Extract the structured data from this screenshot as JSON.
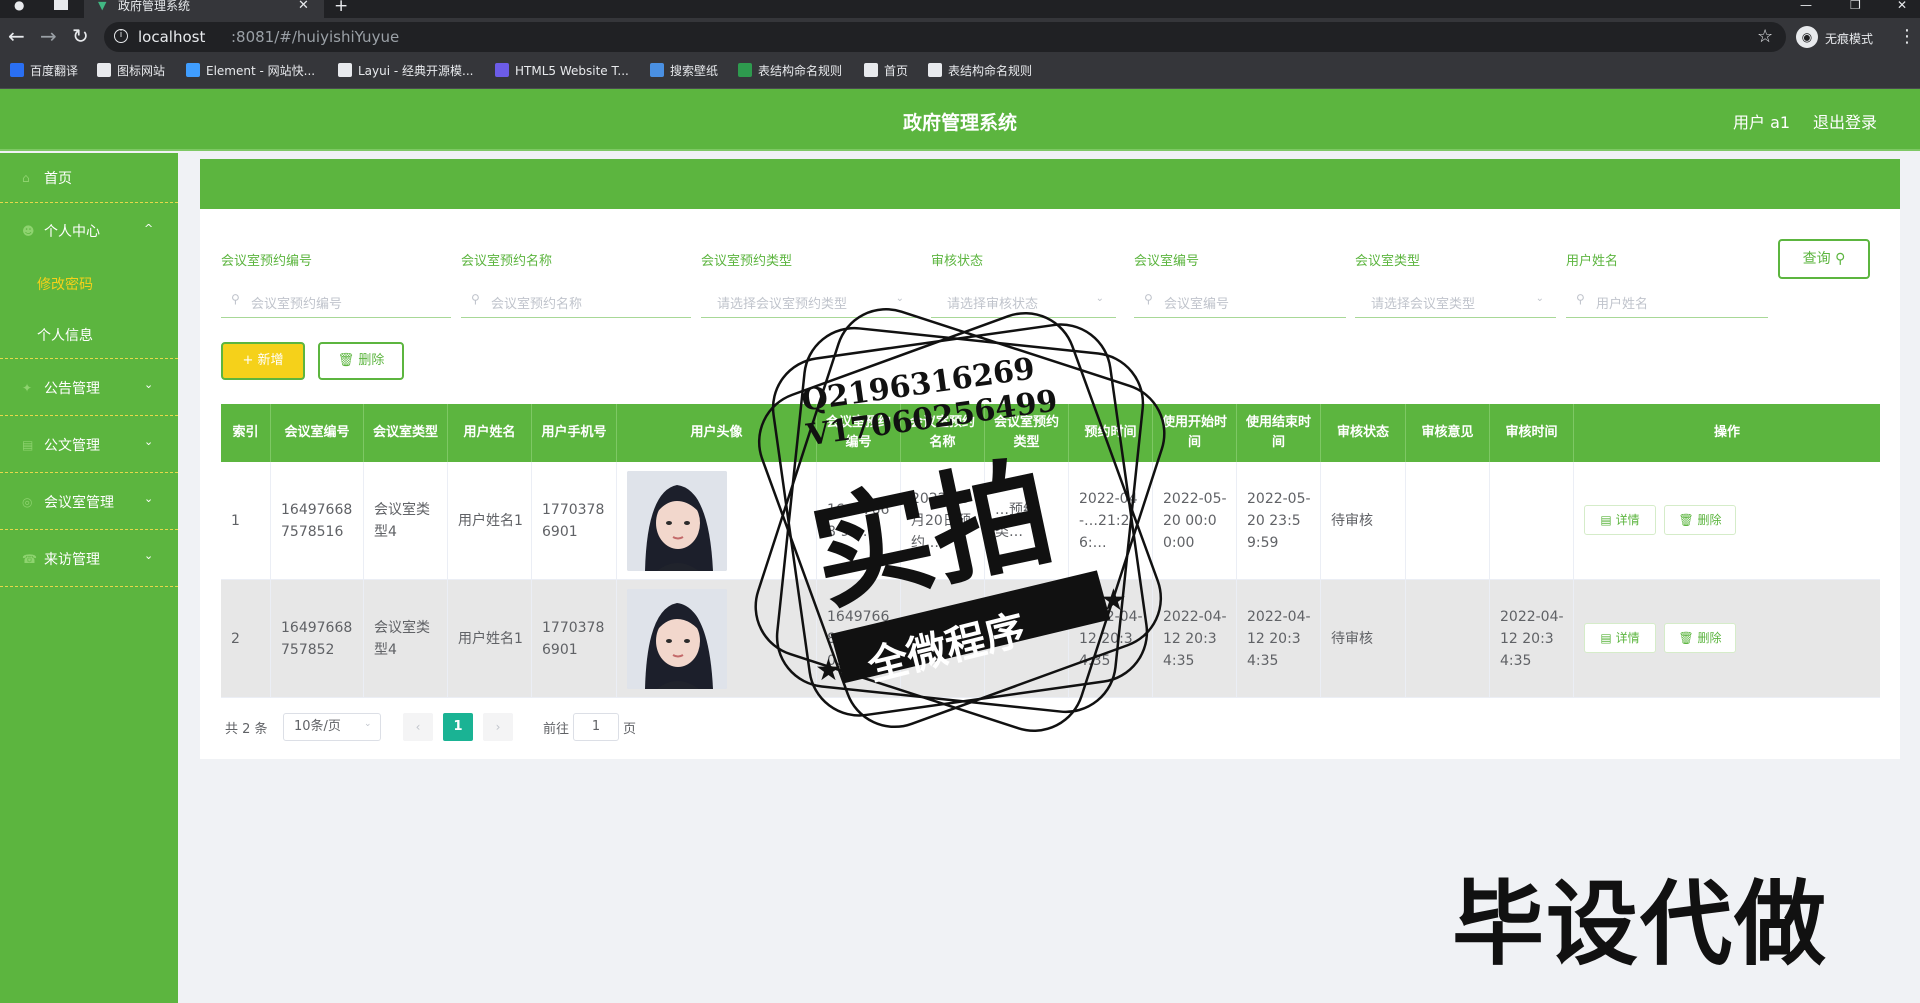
{
  "browser": {
    "tab_title": "政府管理系统",
    "url_host": "localhost",
    "url_path": ":8081/#/huiyishiYuyue",
    "incognito_label": "无痕模式",
    "bookmarks": [
      {
        "label": "百度翻译",
        "icon": "translate-icon",
        "color": "#2a6ff2"
      },
      {
        "label": "图标网站",
        "icon": "flag-icon",
        "color": "#e8eaed"
      },
      {
        "label": "Element - 网站快...",
        "icon": "element-icon",
        "color": "#409eff"
      },
      {
        "label": "Layui - 经典开源模...",
        "icon": "layui-icon",
        "color": "#e8eaed"
      },
      {
        "label": "HTML5 Website T...",
        "icon": "html5-icon",
        "color": "#6c5ce7"
      },
      {
        "label": "搜索壁纸",
        "icon": "wallpaper-icon",
        "color": "#4a90e2"
      },
      {
        "label": "表结构命名规则",
        "icon": "table-icon",
        "color": "#2e9a4e"
      },
      {
        "label": "首页",
        "icon": "globe-icon",
        "color": "#e8eaed"
      },
      {
        "label": "表结构命名规则",
        "icon": "globe-icon",
        "color": "#e8eaed"
      }
    ]
  },
  "header": {
    "title": "政府管理系统",
    "user": "用户 a1",
    "logout": "退出登录"
  },
  "sidebar": {
    "items": [
      {
        "label": "首页",
        "icon": "home-icon",
        "has_arrow": false
      },
      {
        "label": "个人中心",
        "icon": "user-icon",
        "has_arrow": true,
        "arrow": "^"
      },
      {
        "label": "公告管理",
        "icon": "notice-icon",
        "has_arrow": true,
        "arrow": "⌄"
      },
      {
        "label": "公文管理",
        "icon": "document-icon",
        "has_arrow": true,
        "arrow": "⌄"
      },
      {
        "label": "会议室管理",
        "icon": "meeting-icon",
        "has_arrow": true,
        "arrow": "⌄"
      },
      {
        "label": "来访管理",
        "icon": "visitor-icon",
        "has_arrow": true,
        "arrow": "⌄"
      }
    ],
    "sub_items": [
      {
        "label": "修改密码",
        "active": true
      },
      {
        "label": "个人信息",
        "active": false
      }
    ],
    "active_color": "#f5d11a"
  },
  "filters": [
    {
      "label": "会议室预约编号",
      "placeholder": "会议室预约编号",
      "type": "input"
    },
    {
      "label": "会议室预约名称",
      "placeholder": "会议室预约名称",
      "type": "input"
    },
    {
      "label": "会议室预约类型",
      "placeholder": "请选择会议室预约类型",
      "type": "select"
    },
    {
      "label": "审核状态",
      "placeholder": "请选择审核状态",
      "type": "select"
    },
    {
      "label": "会议室编号",
      "placeholder": "会议室编号",
      "type": "input"
    },
    {
      "label": "会议室类型",
      "placeholder": "请选择会议室类型",
      "type": "select"
    },
    {
      "label": "用户姓名",
      "placeholder": "用户姓名",
      "type": "input"
    }
  ],
  "buttons": {
    "search": "查询",
    "add": "+ 新增",
    "delete": "删除"
  },
  "table": {
    "headers": [
      "索引",
      "会议室编号",
      "会议室类型",
      "用户姓名",
      "用户手机号",
      "用户头像",
      "会议室预约编号",
      "会议室预约名称",
      "会议室预约类型",
      "预约时间",
      "使用开始时间",
      "使用结束时间",
      "审核状态",
      "审核意见",
      "审核时间",
      "操作"
    ],
    "rows": [
      {
        "index": "1",
        "room_no": "16497668 7578516",
        "room_type": "会议室类型4",
        "user_name": "用户姓名1",
        "phone": "1770378 6901",
        "booking_no": "16497668 95…",
        "booking_name": "2022年5月20日预约…",
        "booking_type": "…预约类…",
        "booking_time": "2022-04-…21:26:…",
        "start": "2022-05-20 00:00:00",
        "end": "2022-05-20 23:59:59",
        "status": "待审核",
        "opinion": "",
        "review_time": "",
        "detail": "详情",
        "del": "删除"
      },
      {
        "index": "2",
        "room_no": "16497668 757852",
        "room_type": "会议室类型4",
        "user_name": "用户姓名1",
        "phone": "1770378 6901",
        "booking_no": "1649766 875790… 5",
        "booking_name": "",
        "booking_type": "",
        "booking_time": "2022-04-12 20:34:35",
        "start": "2022-04-12 20:34:35",
        "end": "2022-04-12 20:34:35",
        "status": "待审核",
        "opinion": "",
        "review_time": "2022-04-12 20:34:35",
        "detail": "详情",
        "del": "删除"
      }
    ]
  },
  "pagination": {
    "total": "共 2 条",
    "page_size": "10条/页",
    "current": "1",
    "goto_label": "前往",
    "goto_value": "1",
    "goto_unit": "页"
  },
  "watermark": {
    "line1": "Q2196316269",
    "line2": "V17060256499",
    "big": "实拍",
    "ribbon": "全微程序",
    "corner": "毕设代做"
  }
}
